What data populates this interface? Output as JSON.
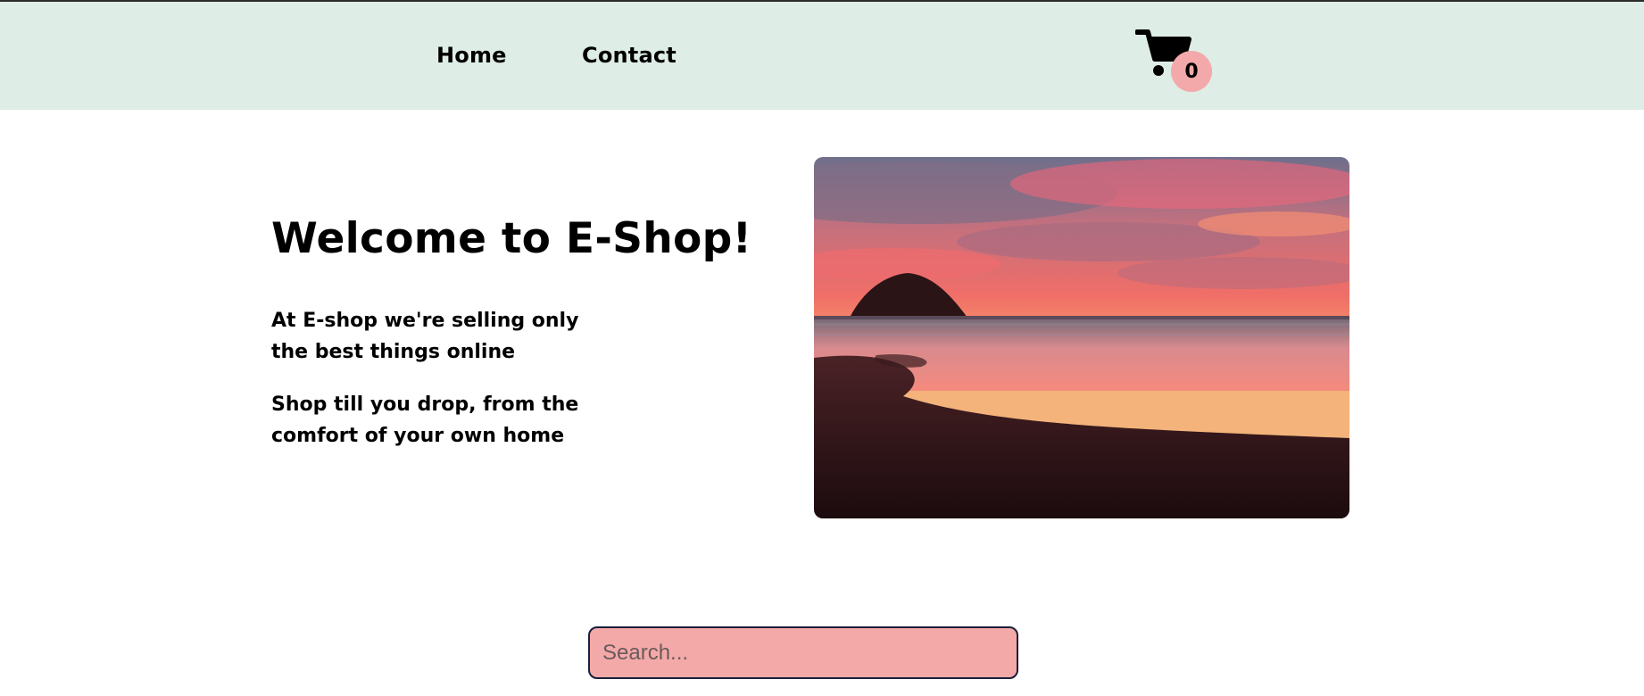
{
  "nav": {
    "home_label": "Home",
    "contact_label": "Contact"
  },
  "cart": {
    "icon": "cart-icon",
    "count": "0",
    "badge_color": "#f3a9a9"
  },
  "hero": {
    "title": "Welcome to E-Shop!",
    "line1": "At E-shop we're selling only the best things online",
    "line2": "Shop till you drop, from the comfort of your own home",
    "image": "sunset-beach-photo"
  },
  "search": {
    "placeholder": "Search...",
    "value": "",
    "background": "#f4a9a9"
  },
  "colors": {
    "navbar": "#deede6",
    "text": "#000000"
  }
}
